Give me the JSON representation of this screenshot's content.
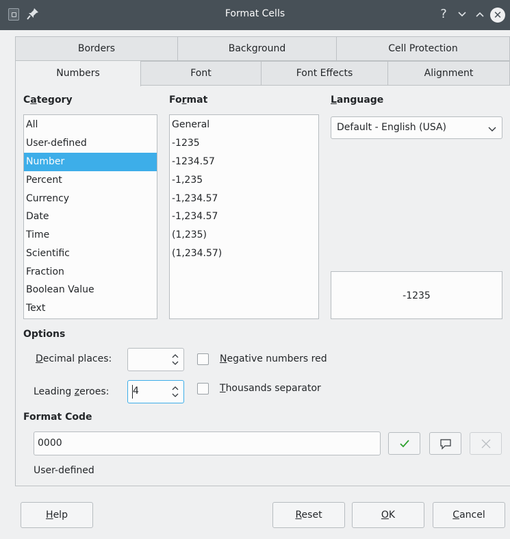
{
  "window": {
    "title": "Format Cells"
  },
  "tabs": {
    "row1": [
      "Borders",
      "Background",
      "Cell Protection"
    ],
    "row2": [
      "Numbers",
      "Font",
      "Font Effects",
      "Alignment"
    ],
    "active": "Numbers"
  },
  "category": {
    "label_pre": "C",
    "label_u": "a",
    "label_post": "tegory",
    "items": [
      "All",
      "User-defined",
      "Number",
      "Percent",
      "Currency",
      "Date",
      "Time",
      "Scientific",
      "Fraction",
      "Boolean Value",
      "Text"
    ],
    "selected": "Number"
  },
  "format": {
    "label_pre": "Fo",
    "label_u": "r",
    "label_post": "mat",
    "items": [
      "General",
      "-1235",
      "-1234.57",
      "-1,235",
      "-1,234.57",
      "-1,234.57",
      "(1,235)",
      "(1,234.57)"
    ]
  },
  "language": {
    "label_u": "L",
    "label_post": "anguage",
    "value": "Default - English (USA)"
  },
  "preview": {
    "value": "-1235"
  },
  "options": {
    "label": "Options",
    "decimal_places": {
      "label_u": "D",
      "label_post": "ecimal places:",
      "value": ""
    },
    "leading_zeroes": {
      "label_pre": "Leading ",
      "label_u": "z",
      "label_post": "eroes:",
      "value": "4"
    },
    "negative_red": {
      "label_u": "N",
      "label_post": "egative numbers red",
      "checked": false
    },
    "thousands_sep": {
      "label_u": "T",
      "label_post": "housands separator",
      "checked": false
    }
  },
  "format_code": {
    "label": "Format Code",
    "value": "0000",
    "description": "User-defined"
  },
  "buttons": {
    "help": {
      "u": "H",
      "post": "elp"
    },
    "reset": {
      "u": "R",
      "post": "eset"
    },
    "ok": {
      "u": "O",
      "post": "K"
    },
    "cancel": {
      "u": "C",
      "post": "ancel"
    }
  },
  "colors": {
    "accent": "#3daee9",
    "titlebar": "#475057",
    "confirm": "#2ca02c"
  }
}
